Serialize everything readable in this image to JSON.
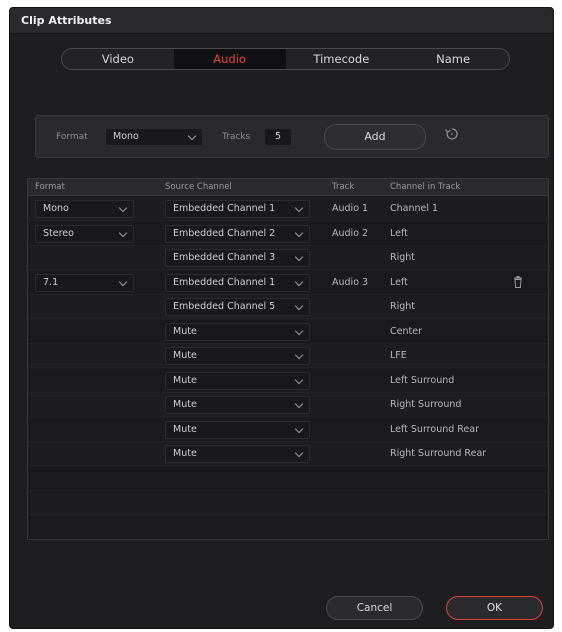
{
  "window": {
    "title": "Clip Attributes"
  },
  "tabs": [
    {
      "label": "Video"
    },
    {
      "label": "Audio"
    },
    {
      "label": "Timecode"
    },
    {
      "label": "Name"
    }
  ],
  "active_tab": "Audio",
  "controls": {
    "format_label": "Format",
    "format_value": "Mono",
    "tracks_label": "Tracks",
    "tracks_value": "5",
    "add_label": "Add",
    "reset_icon": "reset-icon"
  },
  "table": {
    "headers": {
      "format": "Format",
      "source": "Source Channel",
      "track": "Track",
      "channel": "Channel in Track"
    },
    "rows": [
      {
        "format": "Mono",
        "source": "Embedded Channel 1",
        "track": "Audio 1",
        "channel": "Channel 1"
      },
      {
        "format": "Stereo",
        "source": "Embedded Channel 2",
        "track": "Audio 2",
        "channel": "Left"
      },
      {
        "format": "",
        "source": "Embedded Channel 3",
        "track": "",
        "channel": "Right"
      },
      {
        "format": "7.1",
        "source": "Embedded Channel 1",
        "track": "Audio 3",
        "channel": "Left"
      },
      {
        "format": "",
        "source": "Embedded Channel 5",
        "track": "",
        "channel": "Right"
      },
      {
        "format": "",
        "source": "Mute",
        "track": "",
        "channel": "Center"
      },
      {
        "format": "",
        "source": "Mute",
        "track": "",
        "channel": "LFE"
      },
      {
        "format": "",
        "source": "Mute",
        "track": "",
        "channel": "Left Surround"
      },
      {
        "format": "",
        "source": "Mute",
        "track": "",
        "channel": "Right Surround"
      },
      {
        "format": "",
        "source": "Mute",
        "track": "",
        "channel": "Left Surround Rear"
      },
      {
        "format": "",
        "source": "Mute",
        "track": "",
        "channel": "Right Surround Rear"
      }
    ]
  },
  "footer": {
    "cancel_label": "Cancel",
    "ok_label": "OK"
  },
  "colors": {
    "accent": "#e2473a",
    "background": "#1e1e20"
  }
}
